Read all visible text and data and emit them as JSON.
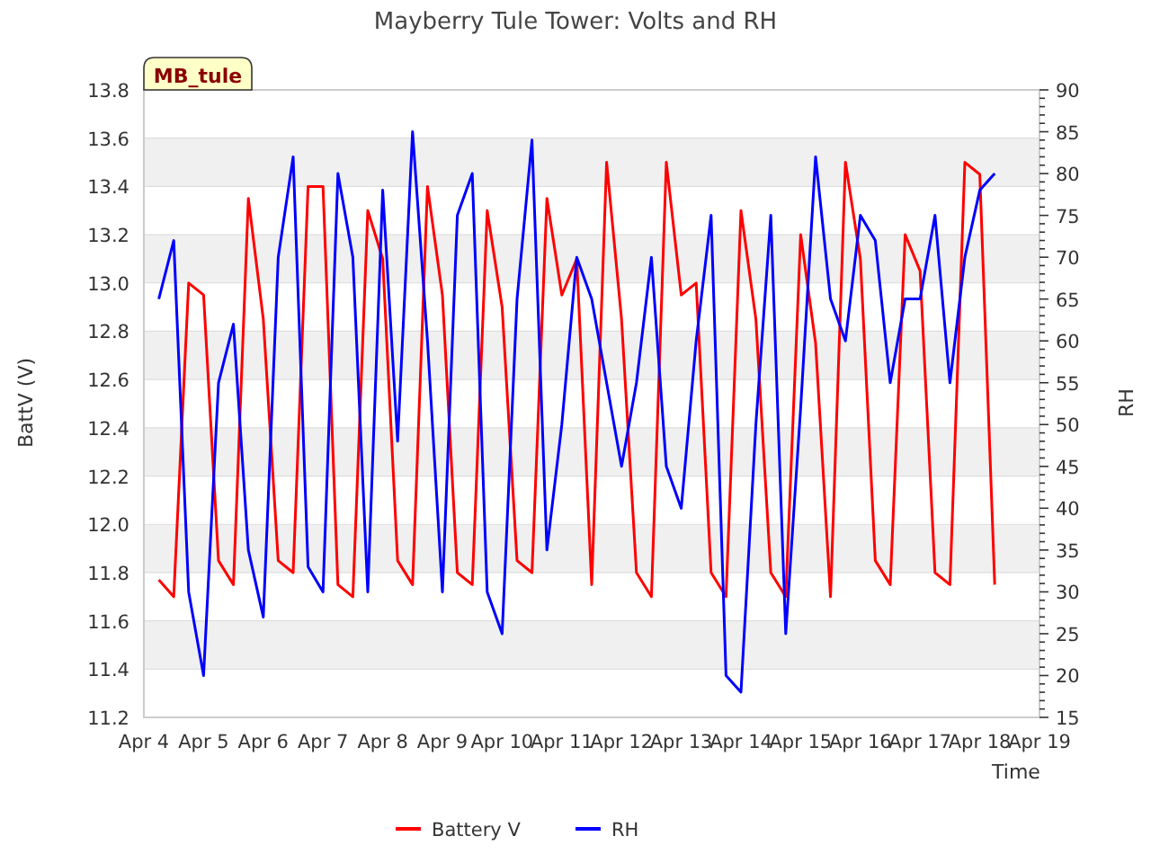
{
  "title": "Mayberry Tule Tower: Volts and RH",
  "site_label": "MB_tule",
  "chart_data": {
    "type": "line",
    "xlabel": "Time",
    "ylabel": "BattV (V)",
    "y2label": "RH",
    "categories": [
      "Apr 4",
      null,
      null,
      null,
      "Apr 5",
      null,
      null,
      null,
      "Apr 6",
      null,
      null,
      null,
      "Apr 7",
      null,
      null,
      null,
      "Apr 8",
      null,
      null,
      null,
      "Apr 9",
      null,
      null,
      null,
      "Apr 10",
      null,
      null,
      null,
      "Apr 11",
      null,
      null,
      null,
      "Apr 12",
      null,
      null,
      null,
      "Apr 13",
      null,
      null,
      null,
      "Apr 14",
      null,
      null,
      null,
      "Apr 15",
      null,
      null,
      null,
      "Apr 16",
      null,
      null,
      null,
      "Apr 17",
      null,
      null,
      null,
      "Apr 18",
      null,
      null,
      null,
      "Apr 19"
    ],
    "series": [
      {
        "name": "Battery V",
        "color": "#ff0000",
        "values": [
          null,
          11.77,
          11.7,
          13.0,
          12.95,
          11.85,
          11.75,
          13.35,
          12.85,
          11.85,
          11.8,
          13.4,
          13.4,
          11.75,
          11.7,
          13.3,
          13.1,
          11.85,
          11.75,
          13.4,
          12.95,
          11.8,
          11.75,
          13.3,
          12.9,
          11.85,
          11.8,
          13.35,
          12.95,
          13.1,
          11.75,
          13.5,
          12.85,
          11.8,
          11.7,
          13.5,
          12.95,
          13.0,
          11.8,
          11.7,
          13.3,
          12.85,
          11.8,
          11.7,
          13.2,
          12.75,
          11.7,
          13.5,
          13.1,
          11.85,
          11.75,
          13.2,
          13.05,
          11.8,
          11.75,
          13.5,
          13.45,
          11.75,
          null,
          null,
          null
        ]
      },
      {
        "name": "RH",
        "color": "#0000ff",
        "axis": "y2",
        "values": [
          null,
          65,
          72,
          30,
          20,
          55,
          62,
          35,
          27,
          70,
          82,
          33,
          30,
          80,
          70,
          30,
          78,
          48,
          85,
          60,
          30,
          75,
          80,
          30,
          25,
          65,
          84,
          35,
          50,
          70,
          65,
          55,
          45,
          55,
          70,
          45,
          40,
          60,
          75,
          20,
          18,
          50,
          75,
          25,
          52,
          82,
          65,
          60,
          75,
          72,
          55,
          65,
          65,
          75,
          55,
          70,
          78,
          80,
          null,
          null,
          null
        ]
      }
    ],
    "ylim": [
      11.2,
      13.8
    ],
    "yticks": [
      {
        "value": 11.2,
        "label": "11.2"
      },
      {
        "value": 11.4,
        "label": "11.4"
      },
      {
        "value": 11.6,
        "label": "11.6"
      },
      {
        "value": 11.8,
        "label": "11.8"
      },
      {
        "value": 12.0,
        "label": "12.0"
      },
      {
        "value": 12.2,
        "label": "12.2"
      },
      {
        "value": 12.4,
        "label": "12.4"
      },
      {
        "value": 12.6,
        "label": "12.6"
      },
      {
        "value": 12.8,
        "label": "12.8"
      },
      {
        "value": 13.0,
        "label": "13.0"
      },
      {
        "value": 13.2,
        "label": "13.2"
      },
      {
        "value": 13.4,
        "label": "13.4"
      },
      {
        "value": 13.6,
        "label": "13.6"
      },
      {
        "value": 13.8,
        "label": "13.8"
      }
    ],
    "grid": true,
    "legend": "bottom",
    "y2lim": [
      15,
      90
    ],
    "y2ticks": [
      15,
      20,
      25,
      30,
      35,
      40,
      45,
      50,
      55,
      60,
      65,
      70,
      75,
      80,
      85,
      90
    ]
  }
}
